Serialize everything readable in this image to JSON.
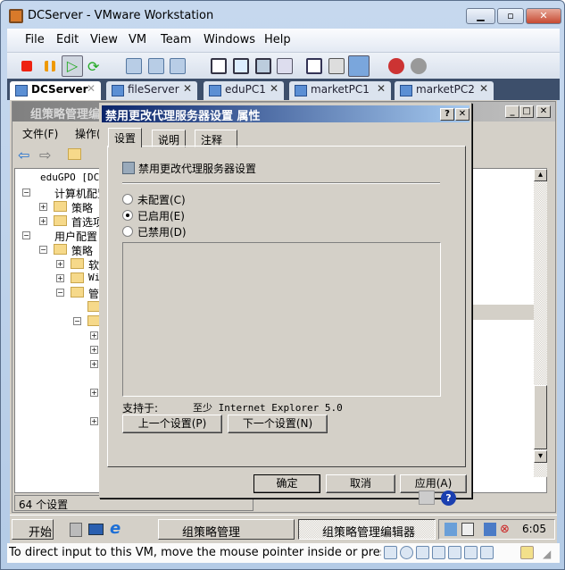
{
  "window": {
    "title": "DCServer - VMware Workstation",
    "buttons": [
      "minimize",
      "restore",
      "close"
    ]
  },
  "menu": [
    "File",
    "Edit",
    "View",
    "VM",
    "Team",
    "Windows",
    "Help"
  ],
  "toolbar_icons": [
    "stop-icon",
    "pause-icon",
    "play-icon",
    "reset-icon",
    "snapshot-icon",
    "revert-snapshot-icon",
    "snapshot-manager-icon",
    "sidebar-icon",
    "fullscreen-icon",
    "quick-switch-icon",
    "console-view-icon",
    "summary-icon",
    "appliance-icon",
    "console-icon",
    "team-icon",
    "clone-icon"
  ],
  "tabs": [
    {
      "label": "DCServer",
      "active": true
    },
    {
      "label": "fileServer"
    },
    {
      "label": "eduPC1"
    },
    {
      "label": "marketPC1"
    },
    {
      "label": "marketPC2"
    }
  ],
  "gpe": {
    "title": "组策略管理编",
    "menu": [
      "文件(F)",
      "操作("
    ],
    "status": "64 个设置",
    "tree": [
      "eduGPO [DCSe",
      "计算机配置",
      "策略",
      "首选项",
      "用户配置",
      "策略",
      "软",
      "Wi",
      "管"
    ]
  },
  "dialog": {
    "title": "禁用更改代理服务器设置 属性",
    "tabs": [
      "设置",
      "说明",
      "注释"
    ],
    "setting_name": "禁用更改代理服务器设置",
    "options": [
      {
        "label": "未配置(C)",
        "selected": false
      },
      {
        "label": "已启用(E)",
        "selected": true
      },
      {
        "label": "已禁用(D)",
        "selected": false
      }
    ],
    "supported_label": "支持于:",
    "supported_value": "至少 Internet Explorer 5.0",
    "prev": "上一个设置(P)",
    "next": "下一个设置(N)",
    "ok": "确定",
    "cancel": "取消",
    "apply": "应用(A)"
  },
  "taskbar": {
    "start": "开始",
    "tasks": [
      {
        "label": "组策略管理",
        "active": false
      },
      {
        "label": "组策略管理编辑器",
        "active": true
      }
    ],
    "time": "6:05"
  },
  "statusbar": {
    "message": "To direct input to this VM, move the mouse pointer inside or press Ctr"
  }
}
